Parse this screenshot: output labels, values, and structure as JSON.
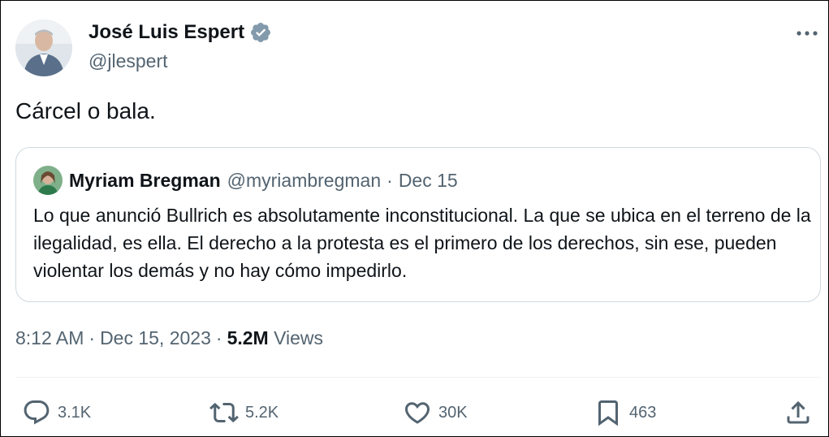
{
  "author": {
    "name": "José Luis Espert",
    "handle": "@jlespert",
    "verified": true
  },
  "tweet": {
    "text": "Cárcel o bala."
  },
  "quote": {
    "name": "Myriam Bregman",
    "handle": "@myriambregman",
    "separator": "·",
    "date": "Dec 15",
    "text": "Lo que anunció Bullrich es absolutamente inconstitucional. La que se ubica en el terreno de la ilegalidad, es ella. El derecho a la protesta es el primero de los derechos,  sin ese, pueden violentar los demás y no hay cómo impedirlo."
  },
  "meta": {
    "time": "8:12 AM",
    "separator": "·",
    "date": "Dec 15, 2023",
    "views_count": "5.2M",
    "views_label": "Views"
  },
  "actions": {
    "replies": "3.1K",
    "reposts": "5.2K",
    "likes": "30K",
    "bookmarks": "463"
  },
  "colors": {
    "text_primary": "#0f1419",
    "text_secondary": "#536471",
    "verified_badge": "#829aab",
    "border": "#cfd9de"
  }
}
